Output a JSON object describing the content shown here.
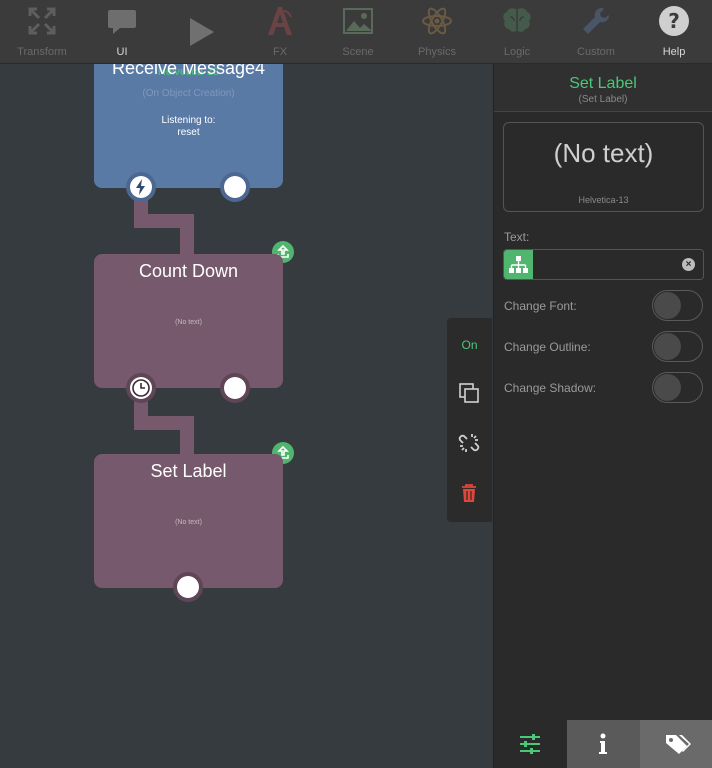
{
  "toolbar": {
    "items": [
      {
        "label": "Transform",
        "icon": "expand-arrows-icon"
      },
      {
        "label": "UI",
        "icon": "speech-bubble-icon"
      },
      {
        "label": "",
        "icon": "play-icon"
      },
      {
        "label": "FX",
        "icon": "fx-icon"
      },
      {
        "label": "Scene",
        "icon": "image-icon"
      },
      {
        "label": "Physics",
        "icon": "atom-icon"
      },
      {
        "label": "Logic",
        "icon": "brain-icon"
      },
      {
        "label": "Custom",
        "icon": "wrench-icon"
      },
      {
        "label": "Help",
        "icon": "question-icon"
      }
    ]
  },
  "nodes": {
    "receive": {
      "title": "Receive Message4",
      "font": "Helvetica-13",
      "subtitle": "(On Object Creation)",
      "listening_label": "Listening to:",
      "listening_value": "reset"
    },
    "countdown": {
      "title": "Count Down",
      "text": "(No text)"
    },
    "setlabel": {
      "title": "Set Label",
      "text": "(No text)"
    }
  },
  "side_toolbar": {
    "on_label": "On"
  },
  "panel": {
    "title": "Set Label",
    "subtitle": "(Set Label)",
    "preview_text": "(No text)",
    "preview_font": "Helvetica-13",
    "text_label": "Text:",
    "text_value": "",
    "change_font_label": "Change Font:",
    "change_outline_label": "Change Outline:",
    "change_shadow_label": "Change Shadow:"
  },
  "colors": {
    "accent_green": "#4cc777",
    "node_blue": "#5a7aa6",
    "node_purple": "#76596c",
    "delete_red": "#e0463a"
  }
}
